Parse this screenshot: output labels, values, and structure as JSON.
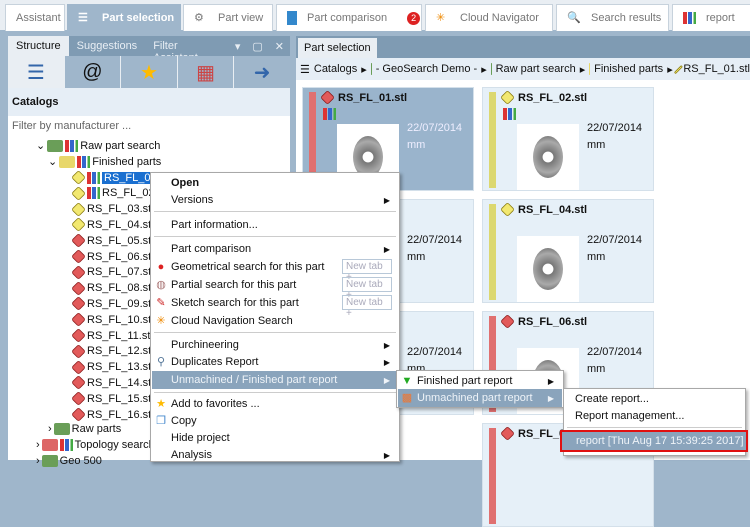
{
  "tabs": [
    {
      "label": "Assistant"
    },
    {
      "label": "Part selection"
    },
    {
      "label": "Part view"
    },
    {
      "label": "Part comparison",
      "badge": "2"
    },
    {
      "label": "Cloud Navigator"
    },
    {
      "label": "Search results"
    },
    {
      "label": "report"
    }
  ],
  "left": {
    "tabs": [
      "Structure",
      "Suggestions",
      "Filter Assistant"
    ],
    "catalogs": "Catalogs",
    "filter_placeholder": "Filter by manufacturer ...",
    "tree": {
      "raw_part_search": "Raw part search",
      "finished_parts": "Finished parts",
      "files": [
        "RS_FL_01.stl",
        "RS_FL_02.stl",
        "RS_FL_03.stl",
        "RS_FL_04.stl",
        "RS_FL_05.stl",
        "RS_FL_06.stl",
        "RS_FL_07.stl",
        "RS_FL_08.stl",
        "RS_FL_09.stl",
        "RS_FL_10.stl",
        "RS_FL_11.stl",
        "RS_FL_12.stl",
        "RS_FL_13.stl",
        "RS_FL_14.stl",
        "RS_FL_15.stl",
        "RS_FL_16.stl"
      ],
      "raw_parts": "Raw parts",
      "topology_search": "Topology search",
      "geo500": "Geo 500"
    }
  },
  "right": {
    "tab": "Part selection",
    "breadcrumb": [
      "Catalogs",
      "- GeoSearch Demo -",
      "Raw part search",
      "Finished parts",
      "RS_FL_01.stl"
    ],
    "cards": [
      {
        "name": "RS_FL_01.stl",
        "date": "22/07/2014",
        "unit": "mm"
      },
      {
        "name": "RS_FL_02.stl",
        "date": "22/07/2014",
        "unit": "mm"
      },
      {
        "date": "22/07/2014",
        "unit": "mm"
      },
      {
        "name": "RS_FL_04.stl",
        "date": "22/07/2014",
        "unit": "mm"
      },
      {
        "date": "22/07/2014",
        "unit": "mm"
      },
      {
        "name": "RS_FL_06.stl",
        "date": "22/07/2014",
        "unit": "mm"
      },
      {
        "name": "RS_FL_08.stl"
      }
    ]
  },
  "menu": {
    "open": "Open",
    "versions": "Versions",
    "part_info": "Part information...",
    "part_comparison": "Part comparison",
    "geo_search": "Geometrical search for this part",
    "partial_search": "Partial search for this part",
    "sketch_search": "Sketch search for this part",
    "cloud_search": "Cloud Navigation Search",
    "purchineering": "Purchineering",
    "duplicates": "Duplicates Report",
    "unmachined_finished": "Unmachined / Finished part report",
    "favorites": "Add to favorites ...",
    "copy": "Copy",
    "hide": "Hide project",
    "analysis": "Analysis",
    "new_tab": "New tab +"
  },
  "submenu1": {
    "finished": "Finished part report",
    "unmachined": "Unmachined part report"
  },
  "submenu2": {
    "create": "Create report...",
    "management": "Report management...",
    "report": "report [Thu Aug 17 15:39:25 2017]"
  }
}
